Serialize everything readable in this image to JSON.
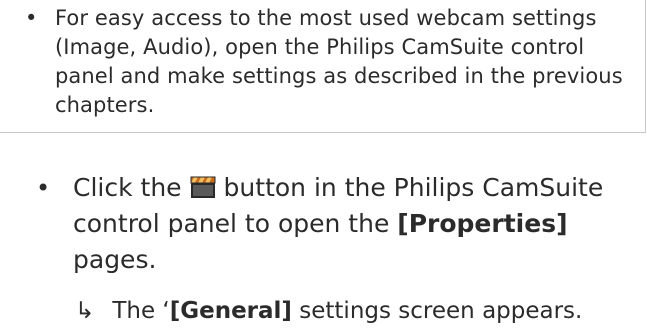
{
  "note": {
    "bullet": "•",
    "text": "For easy access to the most used webcam settings (Image, Audio), open the Philips CamSuite control panel and make settings as described in the previous chapters."
  },
  "step": {
    "bullet": "•",
    "text_before_icon": "Click the",
    "text_after_icon": "button in the Philips CamSuite control panel to open the",
    "bold_term": "[Properties]",
    "text_end": "pages.",
    "icon": "clapperboard-icon"
  },
  "result": {
    "arrow": "↳",
    "text_before": "The ‘",
    "bold_term": "[General]",
    "text_after": "settings screen appears."
  }
}
